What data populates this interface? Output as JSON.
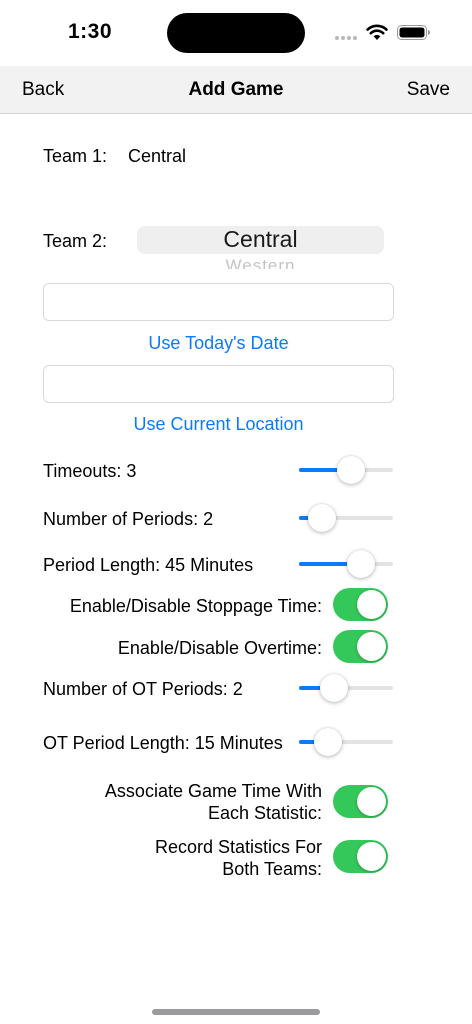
{
  "status": {
    "time": "1:30"
  },
  "nav": {
    "back_label": "Back",
    "title": "Add Game",
    "save_label": "Save"
  },
  "team1": {
    "label": "Team 1:",
    "value": "Central"
  },
  "team2": {
    "label": "Team 2:",
    "selected": "Central",
    "next_option": "Western"
  },
  "date": {
    "value": "",
    "button_label": "Use Today's Date"
  },
  "location": {
    "value": "",
    "button_label": "Use Current Location"
  },
  "timeouts": {
    "label": "Timeouts: 3",
    "level": 0.55
  },
  "periods": {
    "label": "Number of Periods: 2",
    "level": 0.24
  },
  "period_length": {
    "label": "Period Length: 45 Minutes",
    "level": 0.66
  },
  "stoppage": {
    "label": "Enable/Disable Stoppage Time:",
    "on": true
  },
  "overtime": {
    "label": "Enable/Disable Overtime:",
    "on": true
  },
  "ot_periods": {
    "label": "Number of OT Periods: 2",
    "level": 0.37
  },
  "ot_length": {
    "label": "OT Period Length: 15 Minutes",
    "level": 0.31
  },
  "associate": {
    "line1": "Associate Game Time With",
    "line2": "Each Statistic:",
    "on": true
  },
  "record": {
    "line1": "Record Statistics For",
    "line2": "Both Teams:",
    "on": true
  },
  "colors": {
    "accent": "#0a7aff",
    "toggle_on": "#34c759",
    "nav_bg": "#f2f2f3"
  }
}
